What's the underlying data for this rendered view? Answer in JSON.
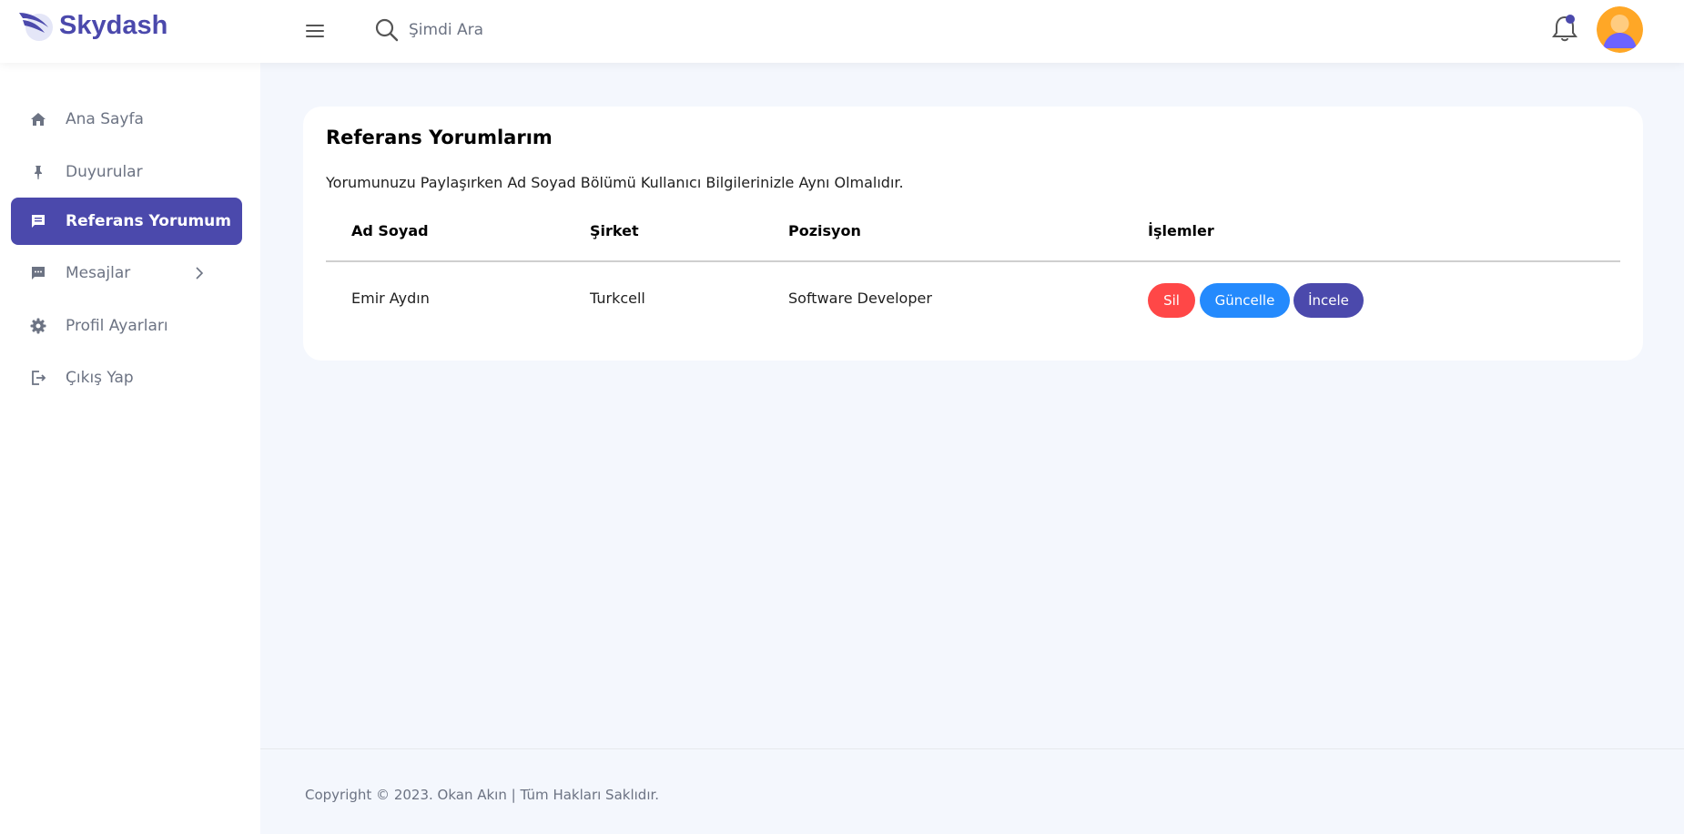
{
  "brand": {
    "name": "Skydash",
    "color": "#4b49ac"
  },
  "search": {
    "placeholder": "Şimdi Ara"
  },
  "sidebar": {
    "items": [
      {
        "label": "Ana Sayfa",
        "icon": "home-icon",
        "active": false
      },
      {
        "label": "Duyurular",
        "icon": "pin-icon",
        "active": false
      },
      {
        "label": "Referans Yorumum",
        "icon": "comment-icon",
        "active": true
      },
      {
        "label": "Mesajlar",
        "icon": "message-icon",
        "active": false,
        "has_submenu": true
      },
      {
        "label": "Profil Ayarları",
        "icon": "gear-icon",
        "active": false
      },
      {
        "label": "Çıkış Yap",
        "icon": "logout-icon",
        "active": false
      }
    ]
  },
  "card": {
    "title": "Referans Yorumlarım",
    "description": "Yorumunuzu Paylaşırken Ad Soyad Bölümü Kullanıcı Bilgilerinizle Aynı Olmalıdır.",
    "columns": [
      "Ad Soyad",
      "Şirket",
      "Pozisyon",
      "İşlemler"
    ],
    "rows": [
      {
        "name": "Emir Aydın",
        "company": "Turkcell",
        "position": "Software Developer",
        "actions": [
          "Sil",
          "Güncelle",
          "İncele"
        ]
      }
    ]
  },
  "footer": {
    "text": "Copyright © 2023. Okan Akın | Tüm Hakları Saklıdır."
  },
  "colors": {
    "primary": "#4b49ac",
    "danger": "#ff4747",
    "info": "#248afd",
    "background": "#f4f7fd",
    "notification_dot": "#4b49ac"
  }
}
